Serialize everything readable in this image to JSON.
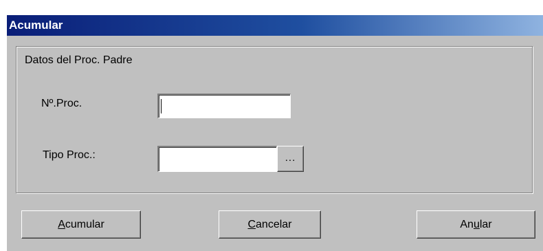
{
  "window": {
    "title": "Acumular"
  },
  "groupbox": {
    "legend": "Datos del Proc. Padre"
  },
  "fields": {
    "num_proc_label": "Nº.Proc.",
    "num_proc_value": "",
    "tipo_proc_label": "Tipo Proc.:",
    "tipo_proc_value": "",
    "browse_label": "..."
  },
  "buttons": {
    "acumular": {
      "mnemonic": "A",
      "rest": "cumular"
    },
    "cancelar": {
      "mnemonic": "C",
      "rest": "ancelar"
    },
    "anular": {
      "before": "An",
      "mnemonic": "u",
      "after": "lar"
    }
  },
  "colors": {
    "titlebar_start": "#0a1e78",
    "titlebar_end": "#8fb3e0",
    "face": "#c0c0c0"
  }
}
